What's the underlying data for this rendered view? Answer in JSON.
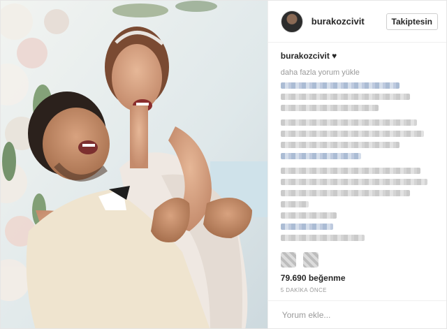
{
  "header": {
    "username": "burakozcivit",
    "follow_label": "Takiptesin"
  },
  "caption": {
    "username": "burakozcivit",
    "text": "♥"
  },
  "comments": {
    "load_more_label": "daha fazla yorum yükle"
  },
  "actions": {
    "like_icon": "heart-icon",
    "comment_icon": "comment-icon"
  },
  "stats": {
    "likes": "79.690 beğenme",
    "time": "5 DAKİKA ÖNCE"
  },
  "add_comment": {
    "placeholder": "Yorum ekle..."
  },
  "colors": {
    "text": "#262626",
    "muted": "#999999",
    "border": "#efefef"
  }
}
